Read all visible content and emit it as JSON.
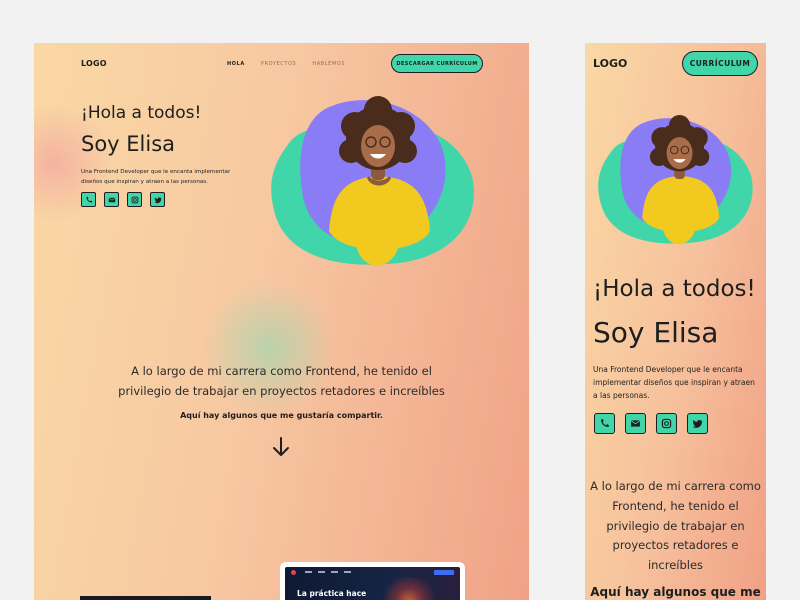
{
  "desktop": {
    "logo": "LOGO",
    "nav": [
      {
        "label": "HOLA",
        "active": true
      },
      {
        "label": "PROYECTOS",
        "active": false
      },
      {
        "label": "HABLEMOS",
        "active": false
      }
    ],
    "cv_button": "DESCARGAR CURRÍCULUM",
    "greeting": "¡Hola a todos!",
    "name": "Soy Elisa",
    "description": "Una Frontend Developer que le encanta implementar diseños que inspiran y atraen a las personas.",
    "social_icons": [
      "phone-icon",
      "mail-icon",
      "instagram-icon",
      "twitter-icon"
    ],
    "career_text": "A lo largo de mi carrera como Frontend, he tenido el privilegio de trabajar en proyectos retadores e increíbles",
    "share_text": "Aquí hay algunos que me gustaría compartir.",
    "project_card_title": "La práctica hace"
  },
  "mobile": {
    "logo": "LOGO",
    "cv_button": "CURRÍCULUM",
    "greeting": "¡Hola a todos!",
    "name": "Soy Elisa",
    "description": "Una Frontend Developer que le encanta implementar diseños que inspiran y atraen a las personas.",
    "career_text": "A lo largo de mi carrera como Frontend, he tenido el privilegio de trabajar en proyectos retadores e increíbles",
    "share_text": "Aquí hay algunos que me"
  },
  "colors": {
    "accent": "#40d6aa",
    "blob_purple": "#8a7cf5",
    "shirt": "#f2c91f",
    "gradient_start": "#fad8a4",
    "gradient_end": "#f0a287"
  }
}
